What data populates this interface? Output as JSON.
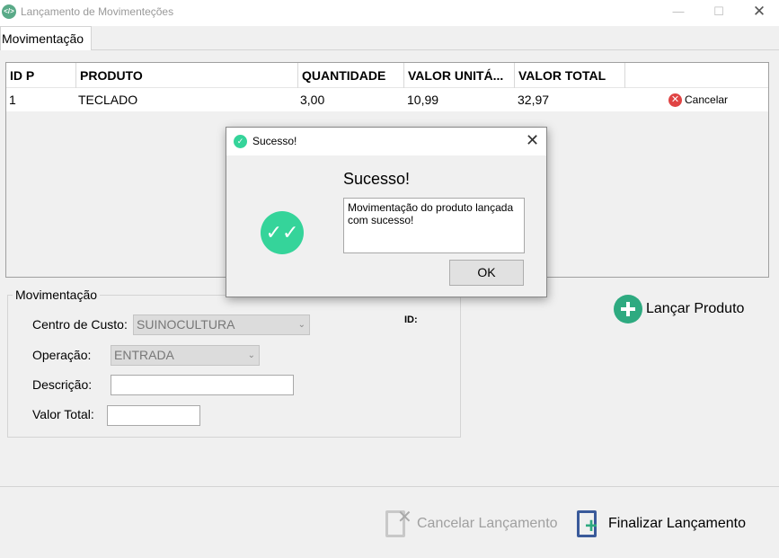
{
  "window": {
    "title": "Lançamento de Movimenteções",
    "minimize": "—",
    "maximize": "☐",
    "close": "✕"
  },
  "tab": {
    "label": "Movimentação"
  },
  "table": {
    "columns": [
      "ID P",
      "PRODUTO",
      "QUANTIDADE",
      "VALOR UNITÁ...",
      "VALOR TOTAL",
      ""
    ],
    "rows": [
      {
        "id": "1",
        "produto": "TECLADO",
        "quantidade": "3,00",
        "valor_unitario": "10,99",
        "valor_total": "32,97",
        "action": "Cancelar"
      }
    ]
  },
  "form": {
    "legend": "Movimentação",
    "centro_label": "Centro de Custo:",
    "centro_value": "SUINOCULTURA",
    "operacao_label": "Operação:",
    "operacao_value": "ENTRADA",
    "descricao_label": "Descrição:",
    "descricao_value": "",
    "valor_total_label": "Valor Total:",
    "valor_total_value": "",
    "id_label": "ID:"
  },
  "actions": {
    "lancar_produto": "Lançar Produto",
    "cancelar_lancamento": "Cancelar Lançamento",
    "finalizar_lancamento": "Finalizar Lançamento"
  },
  "dialog": {
    "title": "Sucesso!",
    "close": "✕",
    "heading": "Sucesso!",
    "message": "Movimentação do produto lançada com sucesso!",
    "ok": "OK"
  },
  "colors": {
    "accent_green": "#2eaa80",
    "success_green": "#35d49a",
    "cancel_red": "#e04444"
  }
}
